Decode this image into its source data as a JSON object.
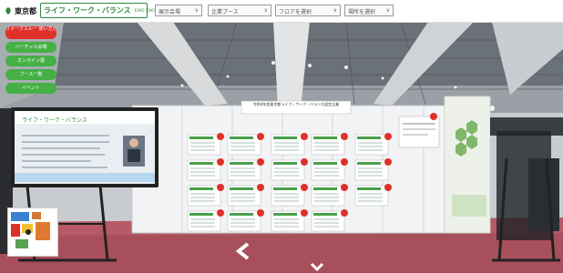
{
  "header": {
    "logo_text": "東京都",
    "brand_title": "ライフ・ワーク・バランス",
    "brand_subtitle": "EXPO TOKYO 2022",
    "selects": [
      {
        "value": "展示会場"
      },
      {
        "value": "企業ブース"
      },
      {
        "value": "フロアを選択"
      },
      {
        "value": "場所を選択"
      }
    ]
  },
  "left_buttons": [
    {
      "label": "ウォークスルー 使い方ガイド",
      "color": "#e0302a"
    },
    {
      "label": "バーチャル会場",
      "color": "#45b045"
    },
    {
      "label": "オンライン展",
      "color": "#45b045"
    },
    {
      "label": "ブース一覧",
      "color": "#45b045"
    },
    {
      "label": "イベント",
      "color": "#45b045"
    }
  ],
  "screen": {
    "title": "ライフ・ワーク・バランス"
  },
  "board": {
    "title": "令和4年度東京都ライフ・ワーク・バランス認定企業"
  },
  "colors": {
    "accent_green": "#2e8b3e",
    "accent_red": "#e0302a",
    "carpet": "#b55a66"
  },
  "icons": [
    "leaf-icon",
    "chevron-down-icon",
    "arrow-left-icon",
    "arrow-down-icon"
  ]
}
